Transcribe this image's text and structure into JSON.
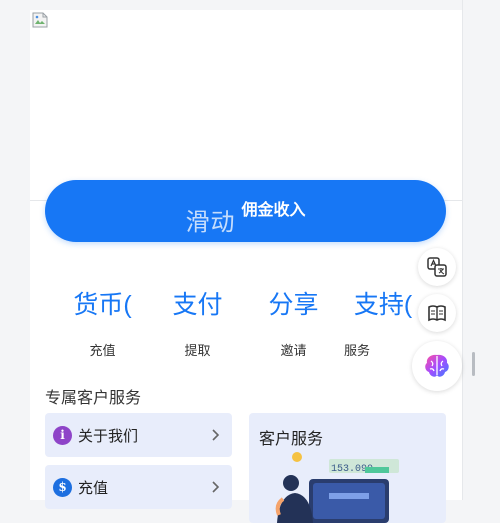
{
  "hero": {
    "image_alt": ""
  },
  "slide_button": {
    "main_label": "滑动",
    "sub_label": "佣金收入"
  },
  "features": [
    {
      "big": "货币(",
      "small": "充值"
    },
    {
      "big": "支付",
      "small": "提取"
    },
    {
      "big": "分享",
      "small": "邀请"
    },
    {
      "big": "支持(",
      "small": "服务"
    }
  ],
  "section": {
    "title": "专属客户服务"
  },
  "menu": [
    {
      "label": "关于我们",
      "icon": "info-icon",
      "icon_glyph": "i",
      "icon_color": "#8e44c8"
    },
    {
      "label": "充值",
      "icon": "dollar-icon",
      "icon_glyph": "$",
      "icon_color": "#1d6fe0"
    }
  ],
  "service_card": {
    "title": "客户服务",
    "illustration_amount": "153.090"
  },
  "colors": {
    "primary": "#1777f5",
    "card_bg": "#e8edfb"
  },
  "floating_tools": [
    {
      "icon": "translate-icon"
    },
    {
      "icon": "reader-icon"
    },
    {
      "icon": "brain-icon"
    }
  ]
}
